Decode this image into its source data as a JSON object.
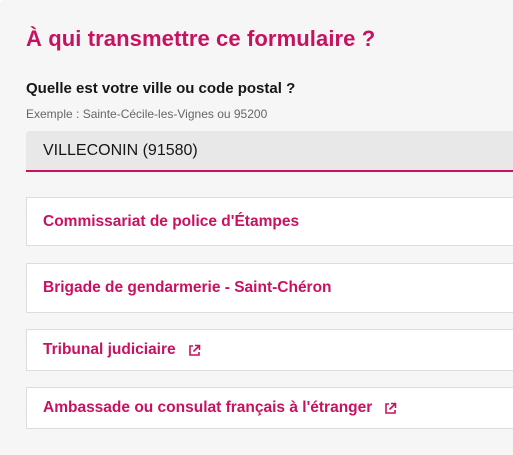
{
  "section": {
    "title": "À qui transmettre ce formulaire ?"
  },
  "city_field": {
    "label": "Quelle est votre ville ou code postal ?",
    "hint": "Exemple : Sainte-Cécile-les-Vignes ou 95200",
    "value": "VILLECONIN (91580)"
  },
  "destinations": [
    {
      "label": "Commissariat de police d'Étampes",
      "external": false
    },
    {
      "label": "Brigade de gendarmerie - Saint-Chéron",
      "external": false
    },
    {
      "label": "Tribunal judiciaire",
      "external": true,
      "icon": "external-link-icon"
    },
    {
      "label": "Ambassade ou consulat français à l'étranger",
      "external": true,
      "icon": "external-link-icon"
    }
  ],
  "colors": {
    "accent": "#c9125f",
    "panel_background": "#f6f6f6",
    "input_background": "#e8e8e8",
    "text": "#161616",
    "hint_text": "#666666"
  }
}
